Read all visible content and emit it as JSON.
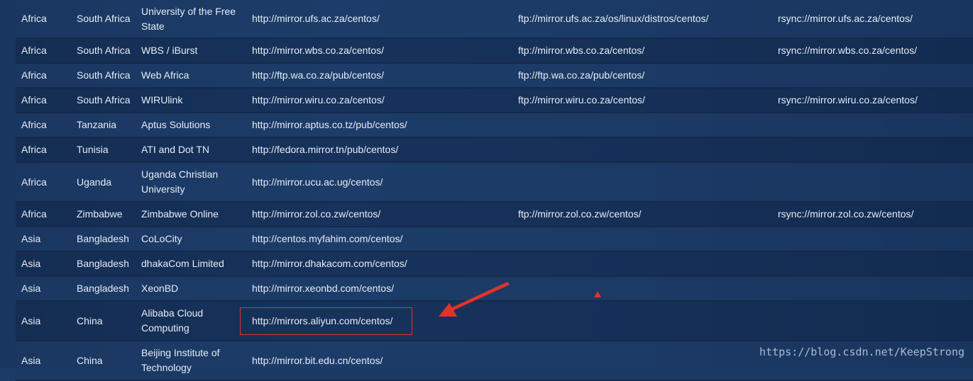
{
  "rows": [
    {
      "continent": "Africa",
      "country": "South Africa",
      "name": "University of the Free State",
      "http": "http://mirror.ufs.ac.za/centos/",
      "ftp": "ftp://mirror.ufs.ac.za/os/linux/distros/centos/",
      "rsync": "rsync://mirror.ufs.ac.za/centos/"
    },
    {
      "continent": "Africa",
      "country": "South Africa",
      "name": "WBS / iBurst",
      "http": "http://mirror.wbs.co.za/centos/",
      "ftp": "ftp://mirror.wbs.co.za/centos/",
      "rsync": "rsync://mirror.wbs.co.za/centos/"
    },
    {
      "continent": "Africa",
      "country": "South Africa",
      "name": "Web Africa",
      "http": "http://ftp.wa.co.za/pub/centos/",
      "ftp": "ftp://ftp.wa.co.za/pub/centos/",
      "rsync": ""
    },
    {
      "continent": "Africa",
      "country": "South Africa",
      "name": "WIRUlink",
      "http": "http://mirror.wiru.co.za/centos/",
      "ftp": "ftp://mirror.wiru.co.za/centos/",
      "rsync": "rsync://mirror.wiru.co.za/centos/"
    },
    {
      "continent": "Africa",
      "country": "Tanzania",
      "name": "Aptus Solutions",
      "http": "http://mirror.aptus.co.tz/pub/centos/",
      "ftp": "",
      "rsync": ""
    },
    {
      "continent": "Africa",
      "country": "Tunisia",
      "name": "ATI and Dot TN",
      "http": "http://fedora.mirror.tn/pub/centos/",
      "ftp": "",
      "rsync": ""
    },
    {
      "continent": "Africa",
      "country": "Uganda",
      "name": "Uganda Christian University",
      "http": "http://mirror.ucu.ac.ug/centos/",
      "ftp": "",
      "rsync": ""
    },
    {
      "continent": "Africa",
      "country": "Zimbabwe",
      "name": "Zimbabwe Online",
      "http": "http://mirror.zol.co.zw/centos/",
      "ftp": "ftp://mirror.zol.co.zw/centos/",
      "rsync": "rsync://mirror.zol.co.zw/centos/"
    },
    {
      "continent": "Asia",
      "country": "Bangladesh",
      "name": "CoLoCity",
      "http": "http://centos.myfahim.com/centos/",
      "ftp": "",
      "rsync": ""
    },
    {
      "continent": "Asia",
      "country": "Bangladesh",
      "name": "dhakaCom Limited",
      "http": "http://mirror.dhakacom.com/centos/",
      "ftp": "",
      "rsync": ""
    },
    {
      "continent": "Asia",
      "country": "Bangladesh",
      "name": "XeonBD",
      "http": "http://mirror.xeonbd.com/centos/",
      "ftp": "",
      "rsync": ""
    },
    {
      "continent": "Asia",
      "country": "China",
      "name": "Alibaba Cloud Computing",
      "http": "http://mirrors.aliyun.com/centos/",
      "ftp": "",
      "rsync": ""
    },
    {
      "continent": "Asia",
      "country": "China",
      "name": "Beijing Institute of Technology",
      "http": "http://mirror.bit.edu.cn/centos/",
      "ftp": "",
      "rsync": ""
    }
  ],
  "watermark": "https://blog.csdn.net/KeepStrong",
  "colors": {
    "annotation_red": "#e2332b",
    "background": "#1b3a66"
  }
}
